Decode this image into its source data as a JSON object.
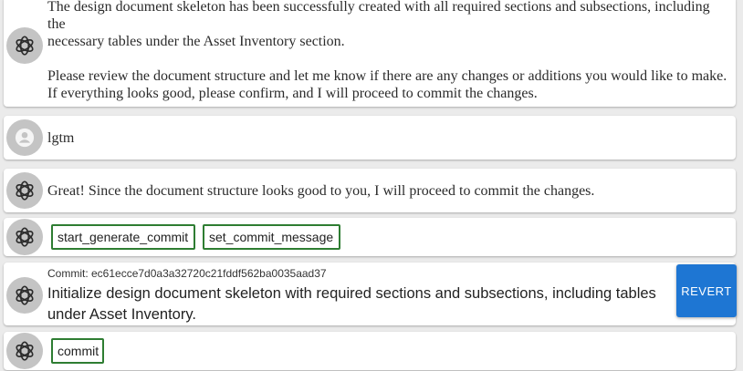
{
  "messages": {
    "m1": {
      "line1": "The design document skeleton has been successfully created with all required sections and subsections, including the",
      "line2": "necessary tables under the Asset Inventory section.",
      "line3": "Please review the document structure and let me know if there are any changes or additions you would like to make.",
      "line4": "If everything looks good, please confirm, and I will proceed to commit the changes."
    },
    "m2": {
      "text": "lgtm"
    },
    "m3": {
      "text": "Great! Since the document structure looks good to you, I will proceed to commit the changes."
    },
    "tools1": [
      "start_generate_commit",
      "set_commit_message"
    ],
    "commit": {
      "label": "Commit: ec61ecce7d0a3a32720c21fddf562ba0035aad37",
      "message": "Initialize design document skeleton with required sections and subsections, including tables under Asset Inventory.",
      "revert_label": "REVERT"
    },
    "tools2": [
      "commit"
    ]
  },
  "icons": {
    "assistant": "openai-logo-icon",
    "user": "user-person-icon"
  },
  "colors": {
    "chip_border": "#2e7d32",
    "revert_button": "#1e76d3",
    "avatar_bg": "#c4c4c4"
  }
}
